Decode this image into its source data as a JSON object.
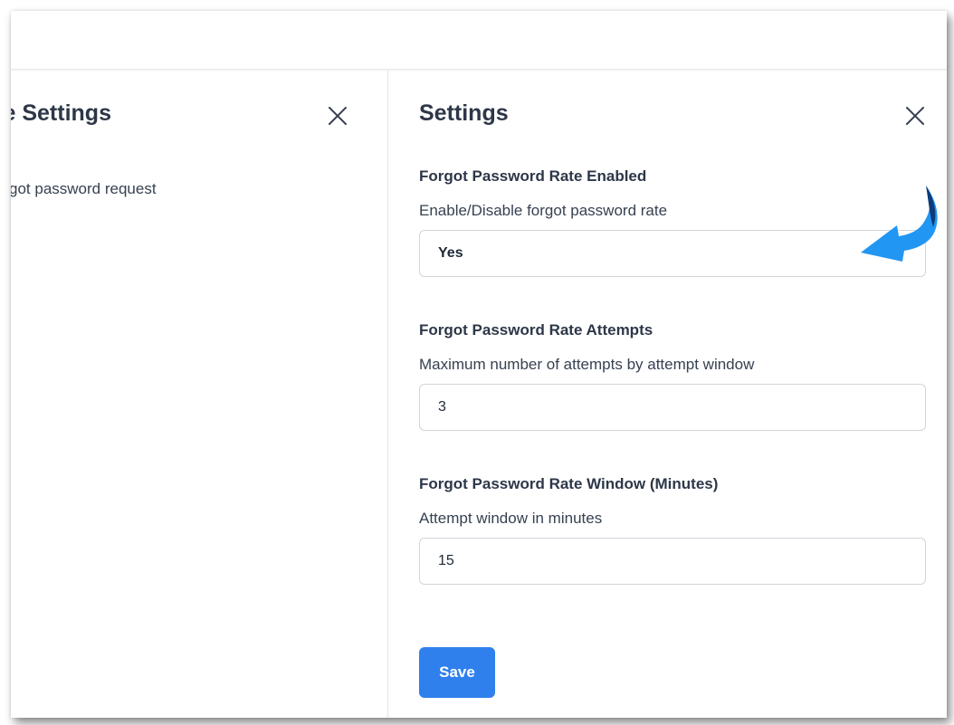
{
  "left_panel": {
    "title": "ord Rate Settings",
    "description": "e forgot password request"
  },
  "right_panel": {
    "title": "Settings",
    "fields": [
      {
        "label": "Forgot Password Rate Enabled",
        "help": "Enable/Disable forgot password rate",
        "value": "Yes"
      },
      {
        "label": "Forgot Password Rate Attempts",
        "help": "Maximum number of attempts by attempt window",
        "value": "3"
      },
      {
        "label": "Forgot Password Rate Window (Minutes)",
        "help": "Attempt window in minutes",
        "value": "15"
      }
    ],
    "save_label": "Save"
  },
  "icons": {
    "close": "close-icon",
    "annotation": "curved-arrow-icon"
  },
  "colors": {
    "primary_button": "#2f80ed",
    "annotation_arrow": "#2196f3",
    "annotation_arrow_dark": "#0d3c78"
  }
}
